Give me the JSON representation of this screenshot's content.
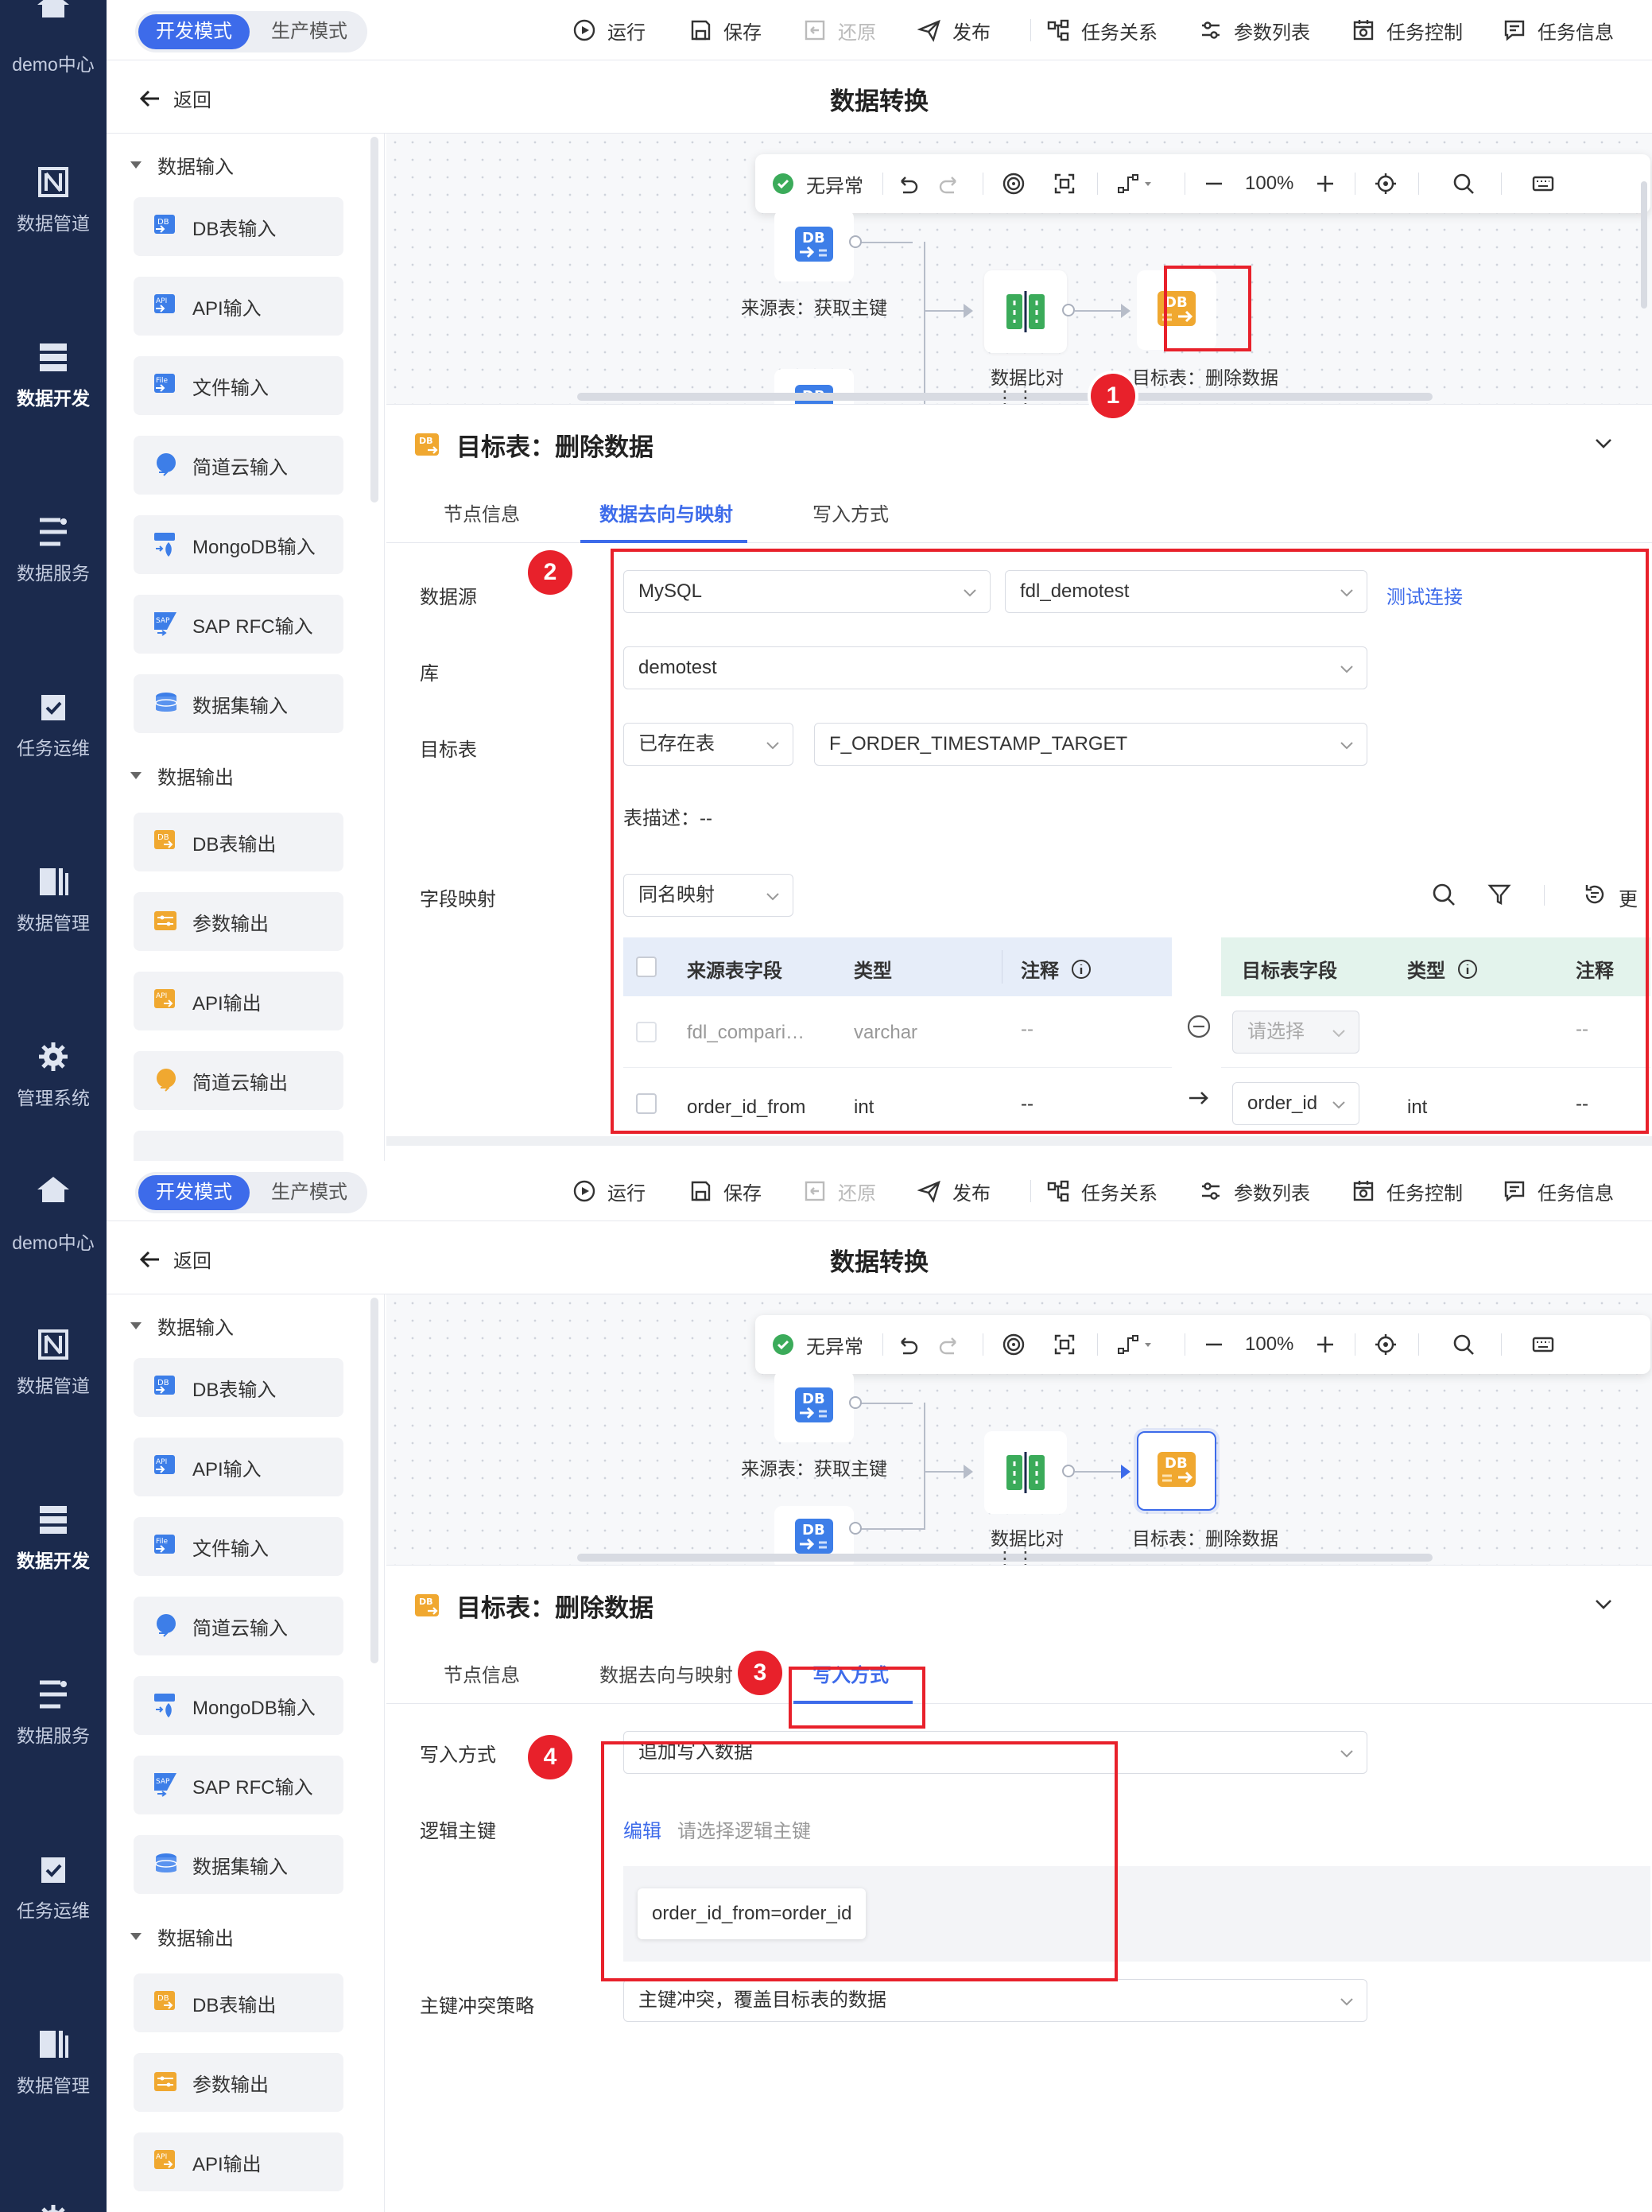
{
  "sidebar": {
    "home": "demo中心",
    "items": [
      "数据管道",
      "数据开发",
      "数据服务",
      "任务运维",
      "数据管理",
      "管理系统"
    ],
    "active": "数据开发"
  },
  "topbar": {
    "mode_dev": "开发模式",
    "mode_prod": "生产模式",
    "run": "运行",
    "save": "保存",
    "restore": "还原",
    "publish": "发布",
    "task_relation": "任务关系",
    "param_list": "参数列表",
    "task_control": "任务控制",
    "task_info": "任务信息"
  },
  "titlebar": {
    "back": "返回",
    "title": "数据转换"
  },
  "panel": {
    "group_input": "数据输入",
    "inputs": [
      "DB表输入",
      "API输入",
      "文件输入",
      "简道云输入",
      "MongoDB输入",
      "SAP RFC输入",
      "数据集输入"
    ],
    "group_output": "数据输出",
    "outputs": [
      "DB表输出",
      "参数输出",
      "API输出",
      "简道云输出"
    ]
  },
  "canvas": {
    "status": "无异常",
    "zoom": "100%",
    "node_source": "来源表：获取主键",
    "node_compare": "数据比对",
    "node_target": "目标表：删除数据",
    "more": "⋮⋮"
  },
  "detail": {
    "title": "目标表：删除数据",
    "tabs": [
      "节点信息",
      "数据去向与映射",
      "写入方式"
    ]
  },
  "mapping": {
    "lbl_source": "数据源",
    "source_type": "MySQL",
    "source_conn": "fdl_demotest",
    "test_link": "测试连接",
    "lbl_db": "库",
    "db": "demotest",
    "lbl_target": "目标表",
    "table_mode": "已存在表",
    "table": "F_ORDER_TIMESTAMP_TARGET",
    "table_desc": "表描述：--",
    "lbl_field_map": "字段映射",
    "map_mode": "同名映射",
    "more_text": "更",
    "src_headers": [
      "来源表字段",
      "类型",
      "注释"
    ],
    "tgt_headers": [
      "目标表字段",
      "类型",
      "注释"
    ],
    "rows": [
      {
        "src": "fdl_compari…",
        "type": "varchar",
        "note": "--",
        "target": "请选择",
        "ttype": "",
        "tnote": "--"
      },
      {
        "src": "order_id_from",
        "type": "int",
        "note": "--",
        "target": "order_id",
        "ttype": "int",
        "tnote": "--"
      }
    ]
  },
  "write": {
    "lbl_mode": "写入方式",
    "mode": "追加写入数据",
    "lbl_pk": "逻辑主键",
    "edit": "编辑",
    "pk_placeholder": "请选择逻辑主键",
    "pk_value": "order_id_from=order_id",
    "lbl_conflict": "主键冲突策略",
    "conflict": "主键冲突，覆盖目标表的数据"
  },
  "badges": [
    "1",
    "2",
    "3",
    "4"
  ],
  "colors": {
    "sidebar": "#1b2a4d",
    "accent": "#3d6bea",
    "highlight": "#e8212b",
    "db_orange": "#f0a830",
    "db_blue": "#3d7ee8",
    "compare_green": "#3bab5a"
  }
}
